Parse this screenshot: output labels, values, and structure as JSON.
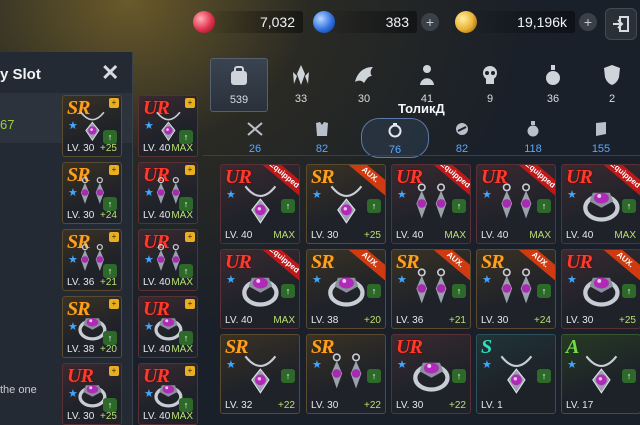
{
  "currency": {
    "red_gem": "7,032",
    "blue_gem": "383",
    "gold": "19,196k"
  },
  "left_panel": {
    "title": "y Slot",
    "stat": "67",
    "desc": "the one"
  },
  "floating_name": "ТоликД",
  "tabs": [
    {
      "icon": "bag-icon",
      "count": "539"
    },
    {
      "icon": "crystal-icon",
      "count": "33"
    },
    {
      "icon": "wing-icon",
      "count": "30"
    },
    {
      "icon": "figure-icon",
      "count": "41"
    },
    {
      "icon": "skull-icon",
      "count": "9"
    },
    {
      "icon": "potion-icon",
      "count": "36"
    },
    {
      "icon": "shield-icon",
      "count": "2"
    }
  ],
  "subtabs": [
    {
      "icon": "crossed-swords-icon",
      "count": "26"
    },
    {
      "icon": "armor-icon",
      "count": "82"
    },
    {
      "icon": "ring-icon",
      "count": "76"
    },
    {
      "icon": "orb-icon",
      "count": "82"
    },
    {
      "icon": "flask-icon",
      "count": "118"
    },
    {
      "icon": "book-icon",
      "count": "155"
    }
  ],
  "left_column_a": [
    {
      "grade": "SR",
      "lv": "LV. 30",
      "bonus": "+25"
    },
    {
      "grade": "SR",
      "lv": "LV. 30",
      "bonus": "+24"
    },
    {
      "grade": "SR",
      "lv": "LV. 36",
      "bonus": "+21"
    },
    {
      "grade": "SR",
      "lv": "LV. 38",
      "bonus": "+20"
    },
    {
      "grade": "UR",
      "lv": "LV. 30",
      "bonus": "+25"
    }
  ],
  "left_column_b": [
    {
      "grade": "UR",
      "lv": "LV. 40",
      "bonus": "MAX"
    },
    {
      "grade": "UR",
      "lv": "LV. 40",
      "bonus": "MAX"
    },
    {
      "grade": "UR",
      "lv": "LV. 40",
      "bonus": "MAX"
    },
    {
      "grade": "UR",
      "lv": "LV. 40",
      "bonus": "MAX"
    },
    {
      "grade": "UR",
      "lv": "LV. 40",
      "bonus": "MAX"
    }
  ],
  "grid": [
    [
      {
        "grade": "UR",
        "lv": "LV. 40",
        "bonus": "MAX",
        "ribbon": "Equipped",
        "art": "necklace-icon"
      },
      {
        "grade": "SR",
        "lv": "LV. 30",
        "bonus": "+25",
        "ribbon": "AUX.",
        "art": "necklace-icon"
      },
      {
        "grade": "UR",
        "lv": "LV. 40",
        "bonus": "MAX",
        "ribbon": "Equipped",
        "art": "earring-icon"
      },
      {
        "grade": "UR",
        "lv": "LV. 40",
        "bonus": "MAX",
        "ribbon": "Equipped",
        "art": "earring-icon"
      },
      {
        "grade": "UR",
        "lv": "LV. 40",
        "bonus": "MAX",
        "ribbon": "Equipped",
        "art": "ring-icon"
      }
    ],
    [
      {
        "grade": "UR",
        "lv": "LV. 40",
        "bonus": "MAX",
        "ribbon": "Equipped",
        "art": "ring-icon"
      },
      {
        "grade": "SR",
        "lv": "LV. 38",
        "bonus": "+20",
        "ribbon": "AUX.",
        "art": "ring-icon"
      },
      {
        "grade": "SR",
        "lv": "LV. 36",
        "bonus": "+21",
        "ribbon": "AUX.",
        "art": "earring-icon"
      },
      {
        "grade": "SR",
        "lv": "LV. 30",
        "bonus": "+24",
        "ribbon": "AUX.",
        "art": "earring-icon"
      },
      {
        "grade": "UR",
        "lv": "LV. 30",
        "bonus": "+25",
        "ribbon": "AUX.",
        "art": "ring-icon"
      }
    ],
    [
      {
        "grade": "SR",
        "lv": "LV. 32",
        "bonus": "+22",
        "ribbon": "",
        "art": "necklace-icon"
      },
      {
        "grade": "SR",
        "lv": "LV. 30",
        "bonus": "+22",
        "ribbon": "",
        "art": "earring-icon"
      },
      {
        "grade": "UR",
        "lv": "LV. 30",
        "bonus": "+22",
        "ribbon": "",
        "art": "ring-icon"
      },
      {
        "grade": "S",
        "lv": "LV. 1",
        "bonus": "",
        "ribbon": "",
        "art": "necklace-icon"
      },
      {
        "grade": "A",
        "lv": "LV. 17",
        "bonus": "",
        "ribbon": "",
        "art": "necklace-icon"
      }
    ]
  ]
}
